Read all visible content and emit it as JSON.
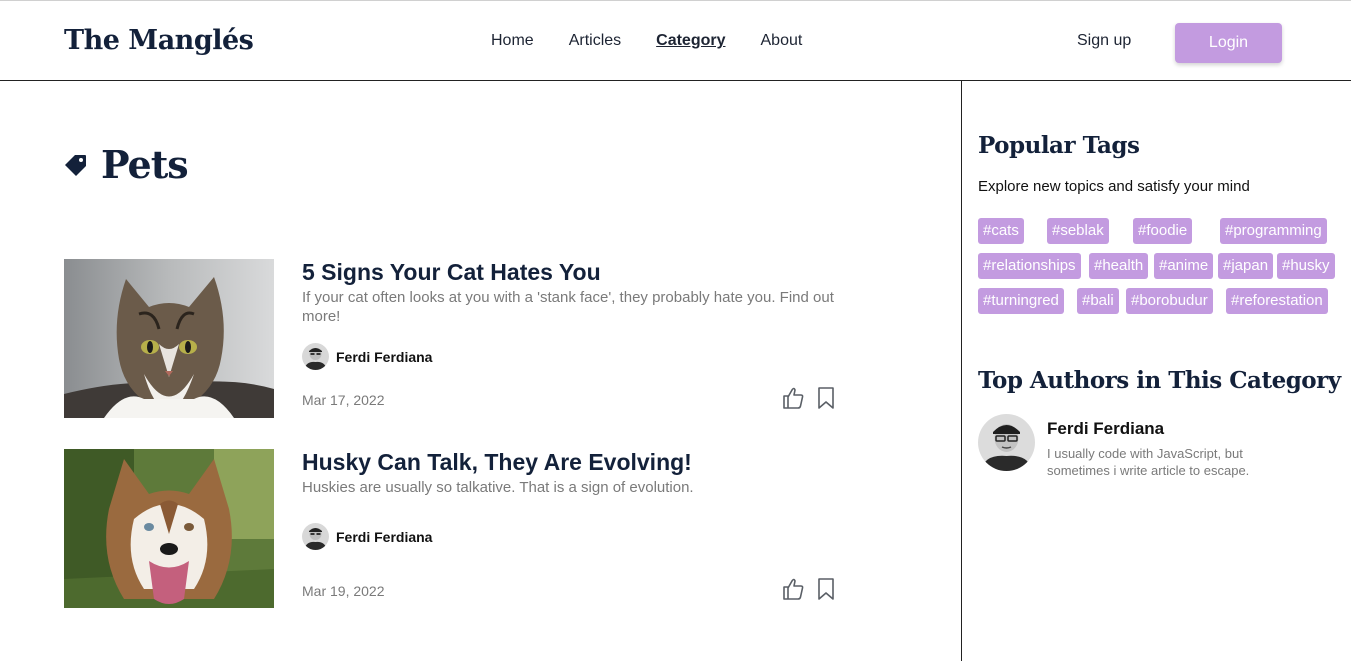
{
  "nav": {
    "brand": "The Manglés",
    "links": [
      "Home",
      "Articles",
      "Category",
      "About"
    ],
    "active": "Category",
    "signup": "Sign up",
    "login": "Login"
  },
  "category": {
    "icon": "tag-icon",
    "title": "Pets"
  },
  "articles": [
    {
      "title": "5 Signs Your Cat Hates You",
      "description": "If your cat often looks at you with a 'stank face', they probably hate you. Find out more!",
      "author": "Ferdi Ferdiana",
      "date": "Mar 17, 2022",
      "image": "cat-photo"
    },
    {
      "title": "Husky Can Talk, They Are Evolving!",
      "description": "Huskies are usually so talkative. That is a sign of evolution.",
      "author": "Ferdi Ferdiana",
      "date": "Mar 19, 2022",
      "image": "husky-photo"
    }
  ],
  "sidebar": {
    "popular_title": "Popular Tags",
    "popular_subtitle": "Explore new topics and satisfy your mind",
    "tags": [
      "#cats",
      "#seblak",
      "#foodie",
      "#programming",
      "#relationships",
      "#health",
      "#anime",
      "#japan",
      "#husky",
      "#turningred",
      "#bali",
      "#borobudur",
      "#reforestation"
    ],
    "authors_title": "Top Authors in This Category",
    "top_author": {
      "name": "Ferdi Ferdiana",
      "bio": "I usually code with JavaScript, but sometimes i write article to escape."
    }
  },
  "colors": {
    "accent": "#c39be0",
    "heading": "#13213a",
    "muted": "#7a7a7a"
  }
}
